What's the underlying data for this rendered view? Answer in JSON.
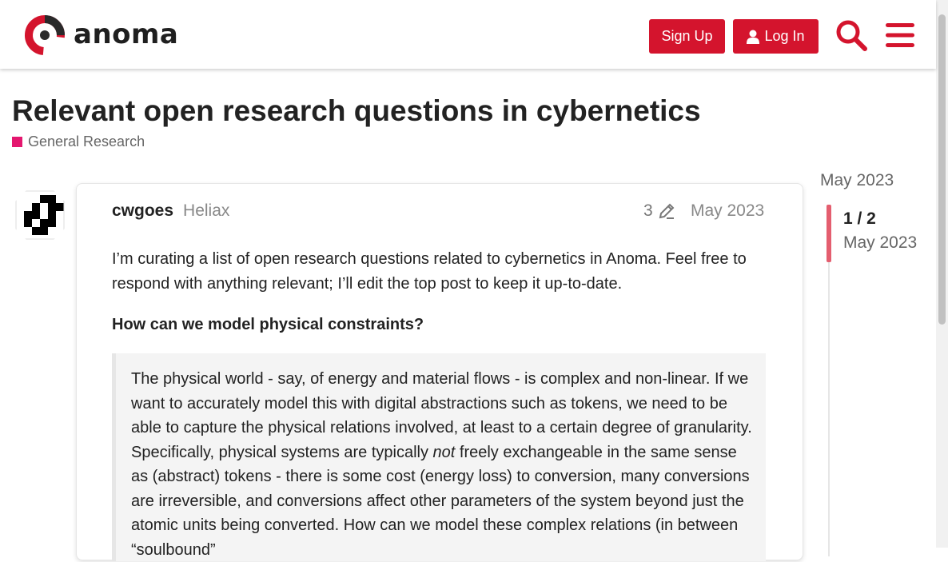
{
  "header": {
    "logo_text": "anoma",
    "signup_label": "Sign Up",
    "login_label": "Log In",
    "brand_color": "#d4142d"
  },
  "topic": {
    "title": "Relevant open research questions in cybernetics",
    "category": "General Research",
    "category_color": "#e4176f"
  },
  "post": {
    "username": "cwgoes",
    "flair": "Heliax",
    "edit_count": "3",
    "date": "May 2023",
    "para1": "I’m curating a list of open research questions related to cybernetics in Anoma. Feel free to respond with anything relevant; I’ll edit the top post to keep it up-to-date.",
    "heading": "How can we model physical constraints?",
    "quote_before": "The physical world - say, of energy and material flows - is complex and non-linear. If we want to accurately model this with digital abstractions such as tokens, we need to be able to capture the physical relations involved, at least to a certain degree of granularity. Specifically, physical systems are typically ",
    "quote_em": "not",
    "quote_after": " freely exchangeable in the same sense as (abstract) tokens - there is some cost (energy loss) to conversion, many conversions are irreversible, and conversions affect other parameters of the system beyond just the atomic units being converted. How can we model these complex relations (in between “soulbound”"
  },
  "timeline": {
    "top_date": "May 2023",
    "position": "1 / 2",
    "bottom_date": "May 2023"
  }
}
